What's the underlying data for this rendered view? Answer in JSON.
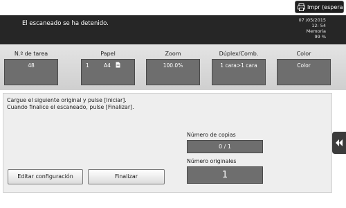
{
  "topbar": {
    "print_button_label": "Impr (espera"
  },
  "header": {
    "status_message": "El escaneado se ha detenido.",
    "date": "07 /05/2015",
    "time": "12: 54",
    "memory_label": "Memoria",
    "memory_value": "99 %"
  },
  "fields": {
    "task": {
      "label": "N.º de tarea",
      "value": "48"
    },
    "paper": {
      "label": "Papel",
      "count": "1",
      "size": "A4"
    },
    "zoom": {
      "label": "Zoom",
      "value": "100.0%"
    },
    "duplex": {
      "label": "Dúplex/Comb.",
      "value": "1 cara>1 cara"
    },
    "color": {
      "label": "Color",
      "value": "Color"
    }
  },
  "message": {
    "line1": "Cargue el siguiente original y pulse [Iniciar].",
    "line2": "Cuando finalice el escaneado, pulse [Finalizar]."
  },
  "copies": {
    "label": "Número de copias",
    "value": "0 / 1"
  },
  "originals": {
    "label": "Número originales",
    "value": "1"
  },
  "buttons": {
    "edit_settings": "Editar configuración",
    "finish": "Finalizar"
  },
  "icons": {
    "printer": "printer-icon",
    "document": "document-icon",
    "side_tab": "double-chevron-left-icon"
  },
  "colors": {
    "header_bg": "#262626",
    "field_box": "#6e6e6e",
    "band_bg": "#d9d9d9"
  }
}
